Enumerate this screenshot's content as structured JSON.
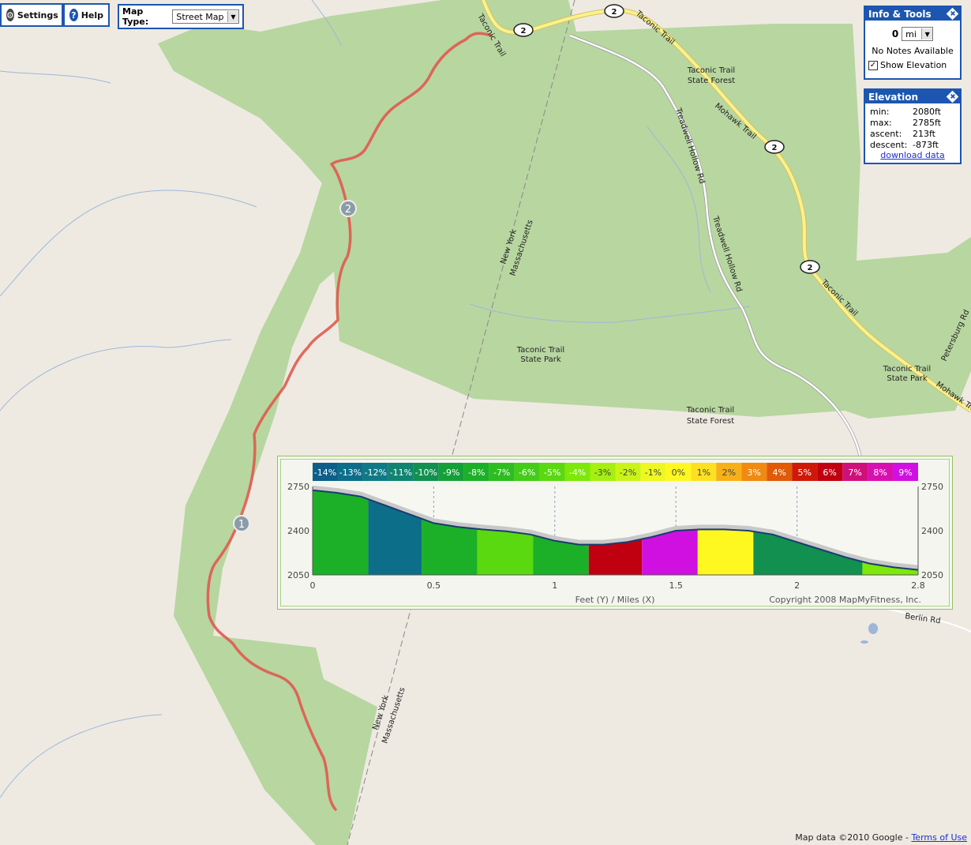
{
  "toolbar": {
    "settings_label": "Settings",
    "help_label": "Help",
    "maptype_label": "Map Type:",
    "maptype_value": "Street Map"
  },
  "info_tools": {
    "title": "Info & Tools",
    "distance_value": "0",
    "unit": "mi",
    "notes": "No Notes Available",
    "show_elevation_label": "Show Elevation",
    "show_elevation_checked": true
  },
  "elevation": {
    "title": "Elevation",
    "rows": [
      {
        "key": "min:",
        "value": "2080ft"
      },
      {
        "key": "max:",
        "value": "2785ft"
      },
      {
        "key": "ascent:",
        "value": "213ft"
      },
      {
        "key": "descent:",
        "value": "-873ft"
      }
    ],
    "download_label": "download data"
  },
  "map_labels": {
    "taconic_trail": "Taconic Trail",
    "mohawk_trail": "Mohawk Trail",
    "treadwell": "Treadwell Hollow Rd",
    "forest_l1": "Taconic Trail",
    "forest_l2": "State Forest",
    "park_l1": "Taconic Trail",
    "park_l2": "State Park",
    "ny": "New York",
    "ma": "Massachusetts",
    "berlin": "Berlin Rd",
    "petersburg": "Petersburg Rd",
    "route": "2",
    "marker1": "1",
    "marker2": "2"
  },
  "attribution": {
    "text": "Map data ©2010 Google - ",
    "terms": "Terms of Use"
  },
  "chart_data": {
    "type": "area",
    "xlabel": "Feet (Y) / Miles (X)",
    "copyright": "Copyright 2008 MapMyFitness, Inc.",
    "x_ticks": [
      "0",
      "0.5",
      "1",
      "1.5",
      "2",
      "2.8"
    ],
    "x_tick_values": [
      0,
      0.5,
      1,
      1.5,
      2,
      2.5
    ],
    "y_ticks": [
      "2750",
      "2400",
      "2050"
    ],
    "y_tick_values": [
      2750,
      2400,
      2050
    ],
    "xlim": [
      0,
      2.5
    ],
    "ylim": [
      2050,
      2750
    ],
    "grade_legend": [
      {
        "label": "-14%",
        "color": "#0d5f8a"
      },
      {
        "label": "-13%",
        "color": "#0d6e8a"
      },
      {
        "label": "-12%",
        "color": "#0f7a86"
      },
      {
        "label": "-11%",
        "color": "#108470"
      },
      {
        "label": "-10%",
        "color": "#119050"
      },
      {
        "label": "-9%",
        "color": "#14a038"
      },
      {
        "label": "-8%",
        "color": "#1cb028"
      },
      {
        "label": "-7%",
        "color": "#2ebd20"
      },
      {
        "label": "-6%",
        "color": "#44cc18"
      },
      {
        "label": "-5%",
        "color": "#5ad810"
      },
      {
        "label": "-4%",
        "color": "#7de80a"
      },
      {
        "label": "-3%",
        "color": "#a5f010"
      },
      {
        "label": "-2%",
        "color": "#caf418"
      },
      {
        "label": "-1%",
        "color": "#eef820"
      },
      {
        "label": "0%",
        "color": "#fff820"
      },
      {
        "label": "1%",
        "color": "#fde020"
      },
      {
        "label": "2%",
        "color": "#f7b018"
      },
      {
        "label": "3%",
        "color": "#f08a10"
      },
      {
        "label": "4%",
        "color": "#e05a08"
      },
      {
        "label": "5%",
        "color": "#d01808"
      },
      {
        "label": "6%",
        "color": "#c00010"
      },
      {
        "label": "7%",
        "color": "#d0107a"
      },
      {
        "label": "8%",
        "color": "#d810b0"
      },
      {
        "label": "9%",
        "color": "#d010e0"
      }
    ],
    "profile": [
      [
        0,
        2720
      ],
      [
        0.1,
        2700
      ],
      [
        0.2,
        2670
      ],
      [
        0.3,
        2600
      ],
      [
        0.4,
        2530
      ],
      [
        0.5,
        2460
      ],
      [
        0.6,
        2430
      ],
      [
        0.7,
        2410
      ],
      [
        0.8,
        2395
      ],
      [
        0.9,
        2370
      ],
      [
        1.0,
        2320
      ],
      [
        1.1,
        2290
      ],
      [
        1.2,
        2290
      ],
      [
        1.3,
        2310
      ],
      [
        1.4,
        2350
      ],
      [
        1.5,
        2400
      ],
      [
        1.6,
        2410
      ],
      [
        1.7,
        2410
      ],
      [
        1.8,
        2400
      ],
      [
        1.9,
        2370
      ],
      [
        2.0,
        2310
      ],
      [
        2.1,
        2250
      ],
      [
        2.2,
        2190
      ],
      [
        2.3,
        2140
      ],
      [
        2.4,
        2110
      ],
      [
        2.5,
        2090
      ]
    ],
    "segments": [
      {
        "x0": 0,
        "x1": 0.23,
        "color": "#1cb028"
      },
      {
        "x0": 0.23,
        "x1": 0.45,
        "color": "#0d6e8a"
      },
      {
        "x0": 0.45,
        "x1": 0.68,
        "color": "#1cb028"
      },
      {
        "x0": 0.68,
        "x1": 0.91,
        "color": "#5ad810"
      },
      {
        "x0": 0.91,
        "x1": 1.14,
        "color": "#1cb028"
      },
      {
        "x0": 1.14,
        "x1": 1.36,
        "color": "#c00010"
      },
      {
        "x0": 1.36,
        "x1": 1.59,
        "color": "#d010e0"
      },
      {
        "x0": 1.59,
        "x1": 1.82,
        "color": "#fff820"
      },
      {
        "x0": 1.82,
        "x1": 2.27,
        "color": "#119050"
      },
      {
        "x0": 2.27,
        "x1": 2.5,
        "color": "#7de80a"
      }
    ]
  }
}
